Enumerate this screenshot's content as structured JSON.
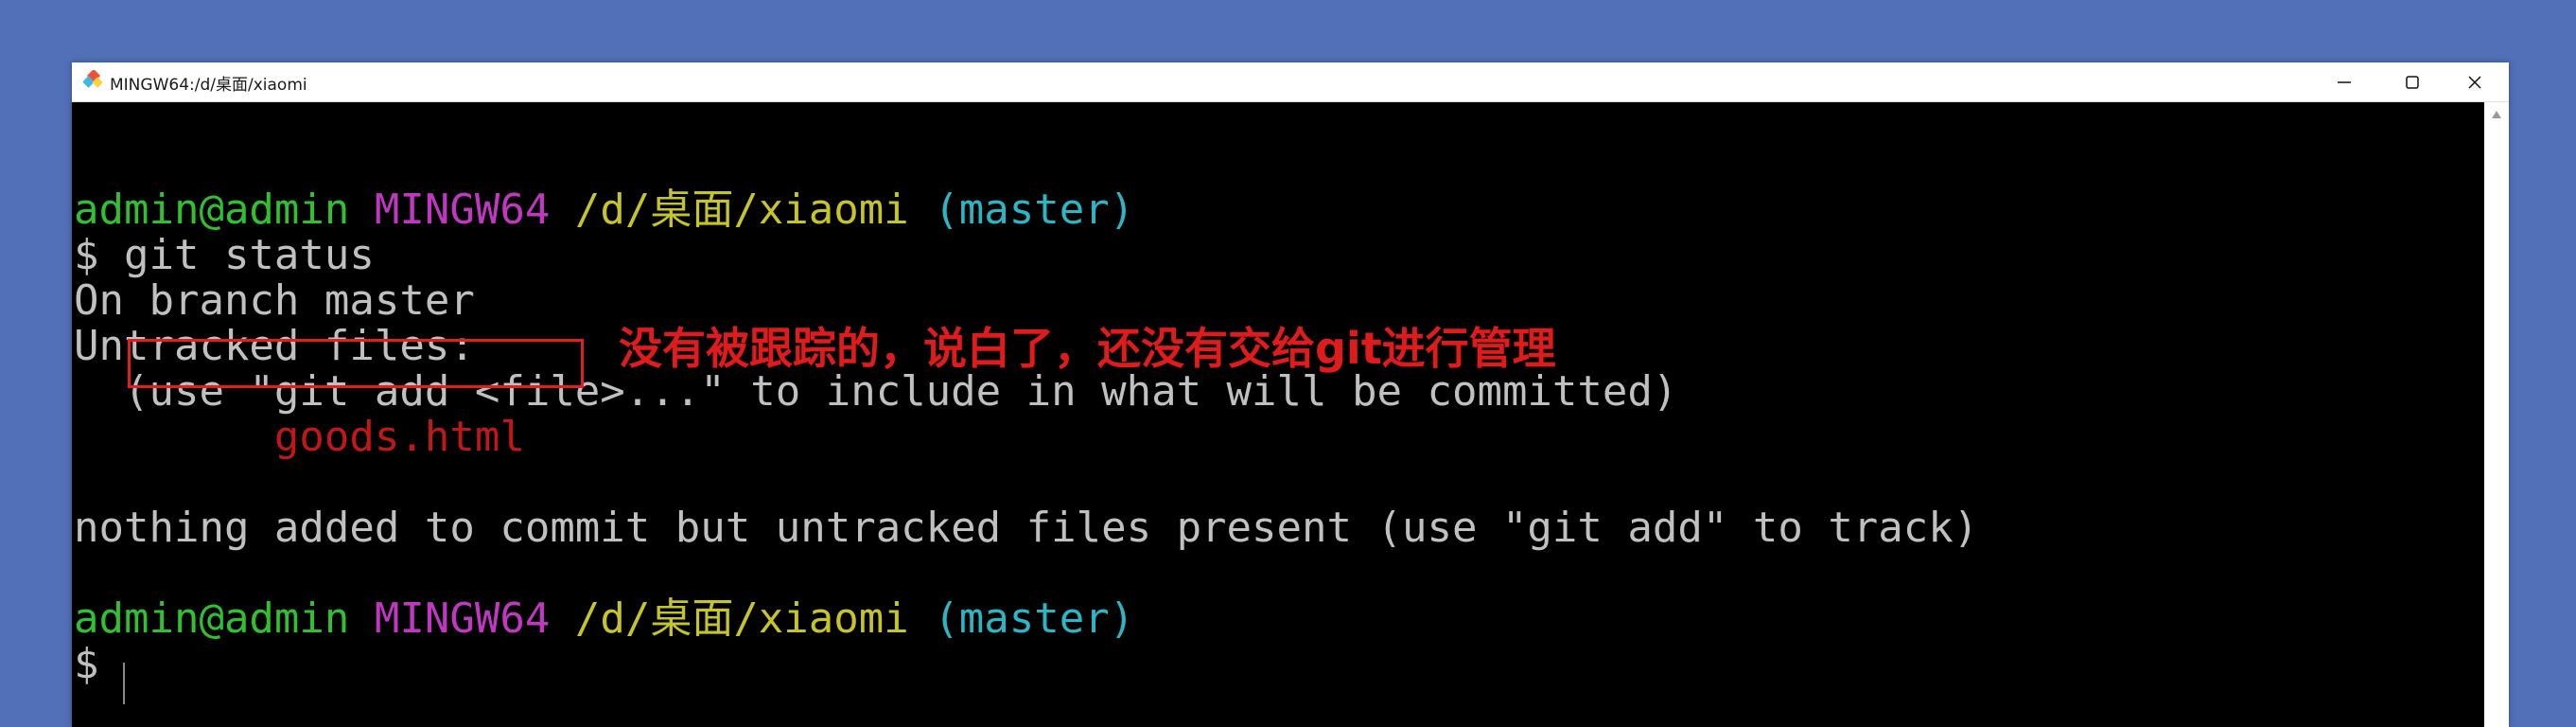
{
  "window": {
    "title": "MINGW64:/d/桌面/xiaomi",
    "icon": "git-bash-icon",
    "controls": [
      "minimize-icon",
      "maximize-icon",
      "close-icon"
    ]
  },
  "terminal": {
    "prompt1": {
      "user": "admin@admin",
      "env": "MINGW64",
      "path": "/d/桌面/xiaomi",
      "branch": "(master)"
    },
    "command": "$ git status",
    "output": {
      "branch_line": "On branch master",
      "untracked_header": "Untracked files:",
      "hint": "  (use \"git add <file>...\" to include in what will be committed)",
      "file": "        goods.html",
      "summary": "nothing added to commit but untracked files present (use \"git add\" to track)"
    },
    "prompt2": {
      "user": "admin@admin",
      "env": "MINGW64",
      "path": "/d/桌面/xiaomi",
      "branch": "(master)"
    },
    "prompt_symbol": "$ "
  },
  "annotation": {
    "text": "没有被跟踪的，说白了，还没有交给git进行管理",
    "color": "#e01b1b"
  },
  "colors": {
    "background": "#5270b8",
    "terminal_bg": "#000000",
    "user": "#2fc12f",
    "env": "#c038c0",
    "path": "#c5c52a",
    "branch": "#2ab7c5",
    "untracked_file": "#c01818",
    "text": "#c0c0c0"
  }
}
